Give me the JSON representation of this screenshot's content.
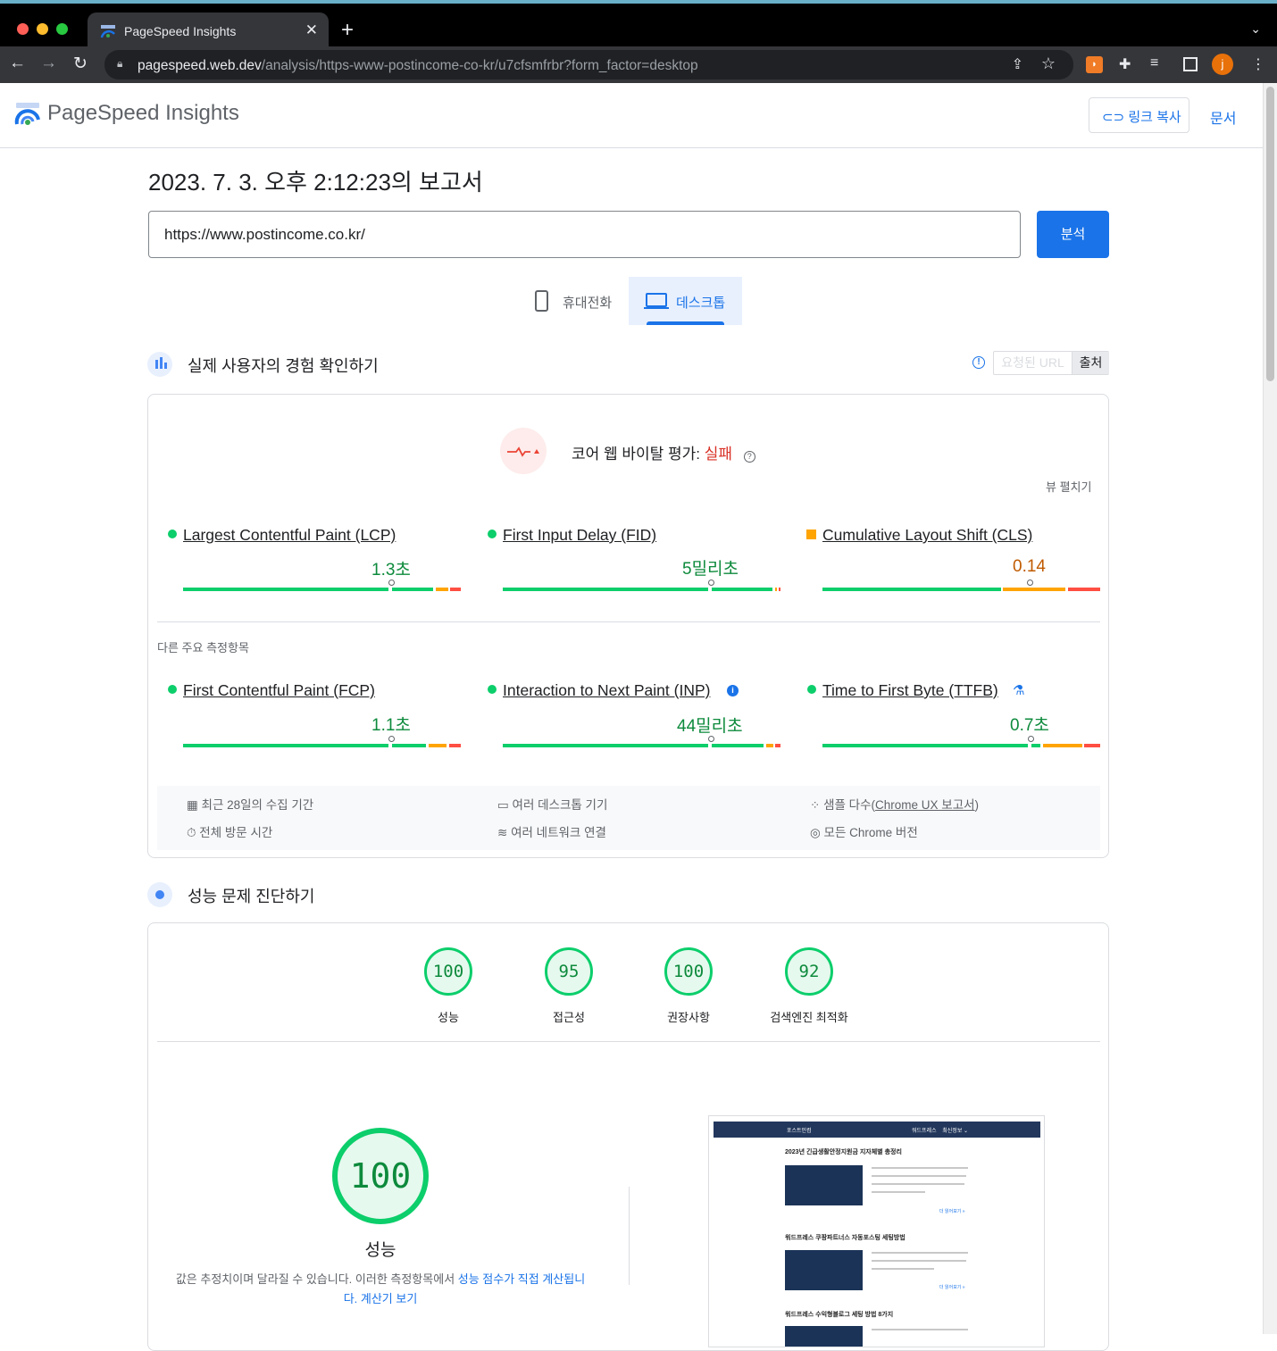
{
  "browser": {
    "tab_title": "PageSpeed Insights",
    "url_host": "pagespeed.web.dev",
    "url_path": "/analysis/https-www-postincome-co-kr/u7cfsmfrbr?form_factor=desktop",
    "profile_initial": "j"
  },
  "header": {
    "brand": "PageSpeed Insights",
    "copy_link": "링크 복사",
    "docs": "문서"
  },
  "report": {
    "title": "2023. 7. 3. 오후 2:12:23의 보고서",
    "url_value": "https://www.postincome.co.kr/",
    "analyze": "분석"
  },
  "device_tabs": {
    "mobile": "휴대전화",
    "desktop": "데스크톱"
  },
  "field": {
    "section_title": "실제 사용자의 경험 확인하기",
    "seg_url": "요청된 URL",
    "seg_origin": "출처",
    "cwv_label": "코어 웹 바이탈 평가: ",
    "cwv_result": "실패",
    "expand": "뷰 펼치기",
    "other_label": "다른 주요 측정항목",
    "metrics": [
      {
        "name": "Largest Contentful Paint (LCP)",
        "value": "1.3초"
      },
      {
        "name": "First Input Delay (FID)",
        "value": "5밀리초"
      },
      {
        "name": "Cumulative Layout Shift (CLS)",
        "value": "0.14"
      },
      {
        "name": "First Contentful Paint (FCP)",
        "value": "1.1초"
      },
      {
        "name": "Interaction to Next Paint (INP)",
        "value": "44밀리초"
      },
      {
        "name": "Time to First Byte (TTFB)",
        "value": "0.7초"
      }
    ],
    "info": {
      "period": "최근 28일의 수집 기간",
      "devices": "여러 데스크톱 기기",
      "samples_prefix": "샘플 다수(",
      "samples_link": "Chrome UX 보고서",
      "samples_suffix": ")",
      "visit": "전체 방문 시간",
      "network": "여러 네트워크 연결",
      "chrome": "모든 Chrome 버전"
    }
  },
  "lab": {
    "section_title": "성능 문제 진단하기",
    "scores": [
      {
        "value": "100",
        "label": "성능"
      },
      {
        "value": "95",
        "label": "접근성"
      },
      {
        "value": "100",
        "label": "권장사항"
      },
      {
        "value": "92",
        "label": "검색엔진 최적화"
      }
    ],
    "big_score": "100",
    "big_label": "성능",
    "note_a": "값은 추정치이며 달라질 수 있습니다. 이러한 측정항목에서 ",
    "note_link": "성능 점수가 직접 계산됩니",
    "note_link2": "다. 계산기 보기",
    "screenshot": {
      "site_name": "포스트인컴",
      "nav": "워드프레스    최신정보 ⌄",
      "post1": "2023년 긴급생활안정지원금 지자체별 총정리",
      "post2": "워드프레스 쿠팡파트너스 자동포스팅 세팅방법",
      "post3": "워드프레스 수익형블로그 세팅 방법 8가지",
      "more": "더 읽어보기 »"
    }
  },
  "colors": {
    "good": "#0cce6b",
    "average": "#ffa400",
    "poor": "#ff4e42",
    "accent": "#1a73e8"
  }
}
